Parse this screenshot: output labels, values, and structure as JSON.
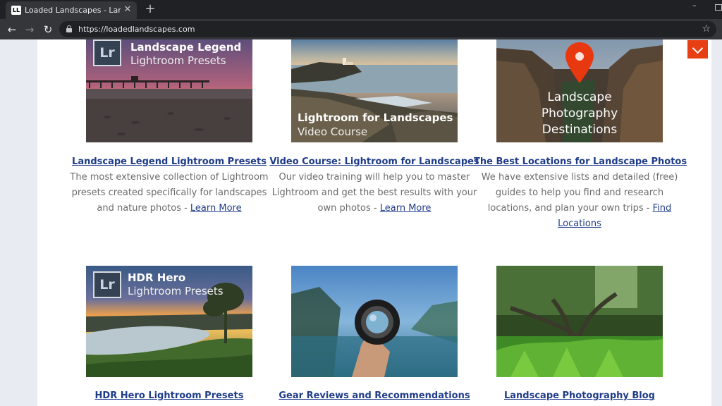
{
  "browser": {
    "tab_title": "Loaded Landscapes - Landscape",
    "favicon_text": "LL",
    "url": "https://loadedlandscapes.com",
    "icons": [
      "back-arrow-icon",
      "forward-arrow-icon",
      "reload-icon",
      "lock-icon",
      "star-icon",
      "close-icon",
      "plus-icon",
      "menu-chevron-icon"
    ],
    "accent_color": "#e83e14"
  },
  "cards": [
    {
      "image": {
        "badge": "Lr",
        "title": "Landscape Legend",
        "subtitle": "Lightroom Presets"
      },
      "title": "Landscape Legend Lightroom Presets",
      "description": "The most extensive collection of Lightroom presets created specifically for landscapes and nature photos - ",
      "link": "Learn More"
    },
    {
      "image": {
        "title": "Lightroom for Landscapes",
        "subtitle": "Video Course"
      },
      "title": "Video Course: Lightroom for Landscapes",
      "description": "Our video training will help you to master Lightroom and get the best results with your own photos - ",
      "link": "Learn More"
    },
    {
      "image": {
        "line1": "Landscape",
        "line2": "Photography",
        "line3": "Destinations"
      },
      "title": "The Best Locations for Landscape Photos",
      "description": "We have extensive lists and detailed (free) guides to help you find and research locations, and plan your own trips - ",
      "link": "Find Locations"
    },
    {
      "image": {
        "badge": "Lr",
        "title": "HDR Hero",
        "subtitle": "Lightroom Presets"
      },
      "title": "HDR Hero Lightroom Presets"
    },
    {
      "title": "Gear Reviews and Recommendations"
    },
    {
      "title": "Landscape Photography Blog"
    }
  ]
}
